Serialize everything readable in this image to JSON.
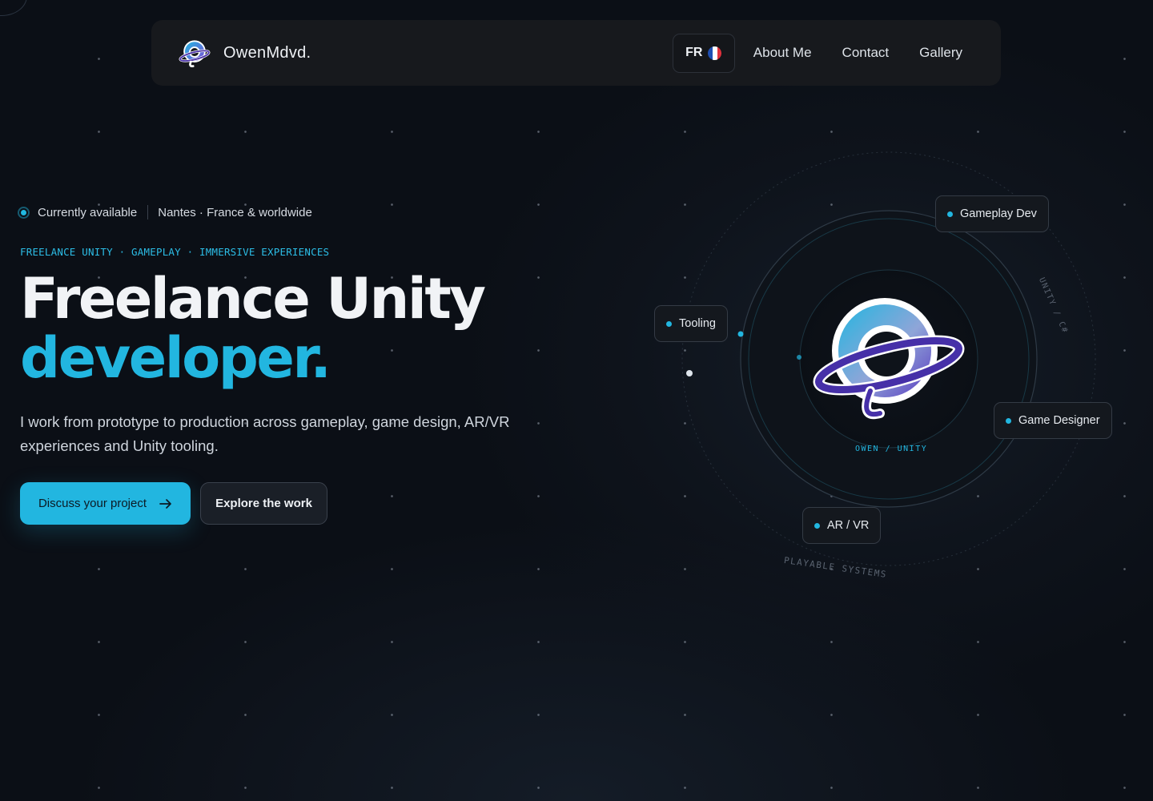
{
  "nav": {
    "brand_name": "OwenMdvd.",
    "lang_label": "FR",
    "links": [
      "About Me",
      "Contact",
      "Gallery"
    ]
  },
  "hero": {
    "status": "Currently available",
    "location": "Nantes · France & worldwide",
    "tagline": "FREELANCE UNITY · GAMEPLAY · IMMERSIVE EXPERIENCES",
    "title_line1": "Freelance Unity",
    "title_line2": "developer.",
    "lead": "I work from prototype to production across gameplay, game design, AR/VR experiences and Unity tooling.",
    "primary_cta": "Discuss your project",
    "secondary_cta": "Explore the work"
  },
  "orbit": {
    "tags": [
      "Gameplay Dev",
      "Tooling",
      "Game Designer",
      "AR / VR"
    ],
    "center_label": "OWEN / UNITY",
    "ring_text_right": "UNITY / C#",
    "ring_text_bottom": "PLAYABLE SYSTEMS"
  },
  "colors": {
    "accent": "#22b6e0",
    "background": "#0b0f16",
    "nav_bg": "#17191d",
    "flag_blue": "#1f4fb3",
    "flag_white": "#ffffff",
    "flag_red": "#e0313c"
  },
  "icons": {
    "brand": "planet-logo-icon",
    "cta_arrow": "arrow-right-icon",
    "status": "status-dot-icon"
  }
}
